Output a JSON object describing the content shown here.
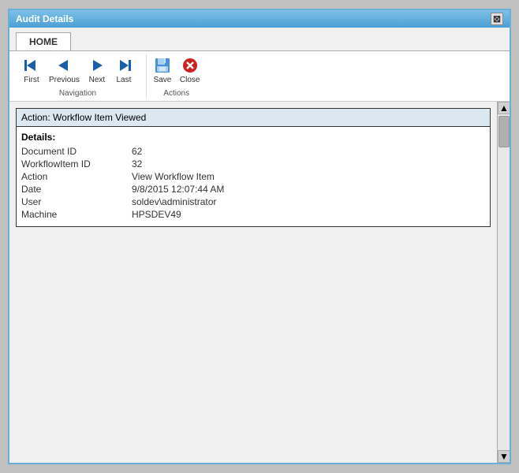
{
  "window": {
    "title": "Audit Details",
    "close_btn": "✕"
  },
  "tabs": [
    {
      "label": "HOME",
      "active": true
    }
  ],
  "ribbon": {
    "navigation_group": {
      "label": "Navigation",
      "buttons": [
        {
          "id": "first",
          "label": "First",
          "icon": "⏮"
        },
        {
          "id": "previous",
          "label": "Previous",
          "icon": "◀"
        },
        {
          "id": "next",
          "label": "Next",
          "icon": "▶"
        },
        {
          "id": "last",
          "label": "Last",
          "icon": "⏭"
        }
      ]
    },
    "actions_group": {
      "label": "Actions",
      "buttons": [
        {
          "id": "save",
          "label": "Save"
        },
        {
          "id": "close",
          "label": "Close"
        }
      ]
    }
  },
  "audit": {
    "action_label": "Action:",
    "action_value": "Workflow Item Viewed",
    "details_header": "Details:",
    "fields": [
      {
        "label": "Document ID",
        "value": "62"
      },
      {
        "label": "WorkflowItem ID",
        "value": "32"
      },
      {
        "label": "Action",
        "value": "View Workflow Item"
      },
      {
        "label": "Date",
        "value": "9/8/2015 12:07:44 AM"
      },
      {
        "label": "User",
        "value": "soldev\\administrator"
      },
      {
        "label": "Machine",
        "value": "HPSDEV49"
      }
    ]
  },
  "scrollbar": {
    "up_arrow": "▲",
    "down_arrow": "▼"
  }
}
